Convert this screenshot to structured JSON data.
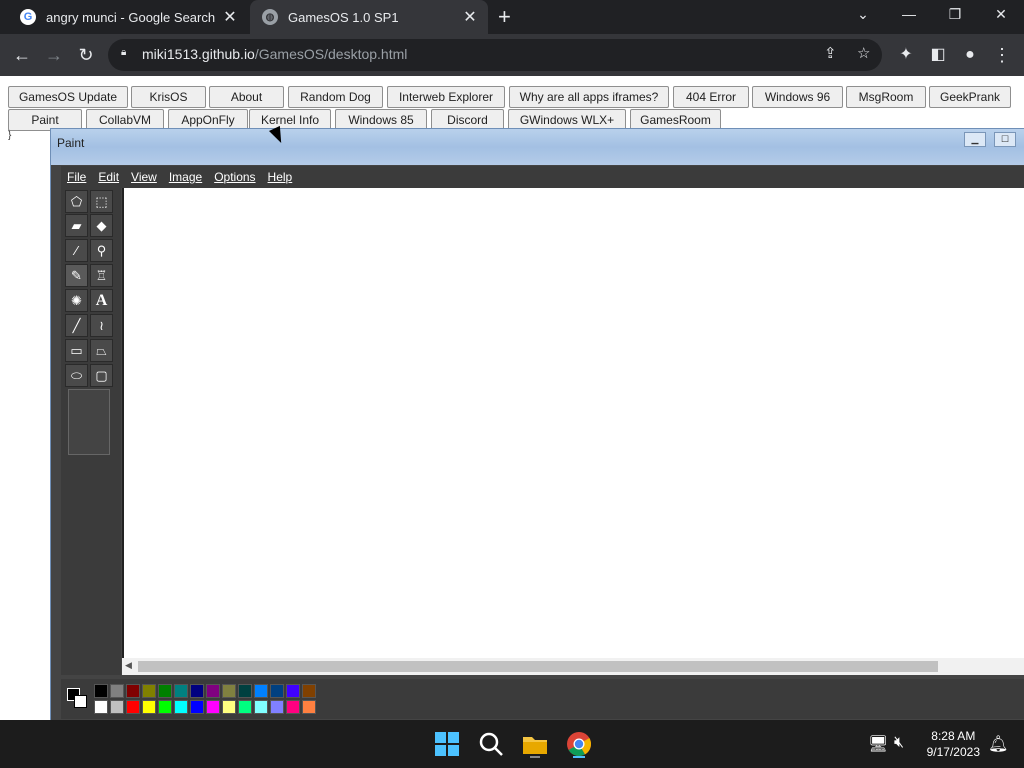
{
  "browser": {
    "tabs": [
      {
        "title": "angry munci - Google Search",
        "favicon": "google-icon"
      },
      {
        "title": "GamesOS 1.0 SP1",
        "favicon": "globe-icon"
      }
    ],
    "url_host": "miki1513.github.io",
    "url_path": "/GamesOS/desktop.html"
  },
  "app_buttons_row1": [
    "GamesOS Update",
    "KrisOS",
    "About",
    "Random Dog",
    "Interweb Explorer",
    "Why are all apps iframes?",
    "404 Error",
    "Windows 96",
    "MsgRoom",
    "GeekPrank"
  ],
  "app_buttons_row2": [
    "Paint",
    "CollabVM",
    "AppOnFly",
    "Kernel Info",
    "Windows 85",
    "Discord",
    "GWindows WLX+",
    "GamesRoom"
  ],
  "stray_text": "}",
  "paint": {
    "title": "Paint",
    "menu": [
      "File",
      "Edit",
      "View",
      "Image",
      "Options",
      "Help"
    ],
    "text_tool_glyph": "A",
    "palette_row1": [
      "#000000",
      "#808080",
      "#800000",
      "#808000",
      "#008000",
      "#008080",
      "#000080",
      "#800080",
      "#808040",
      "#004040",
      "#0080ff",
      "#004080",
      "#4000ff",
      "#804000"
    ],
    "palette_row2": [
      "#ffffff",
      "#c0c0c0",
      "#ff0000",
      "#ffff00",
      "#00ff00",
      "#00ffff",
      "#0000ff",
      "#ff00ff",
      "#ffff80",
      "#00ff80",
      "#80ffff",
      "#8080ff",
      "#ff0080",
      "#ff8040"
    ]
  },
  "taskbar": {
    "time": "8:28 AM",
    "date": "9/17/2023"
  }
}
